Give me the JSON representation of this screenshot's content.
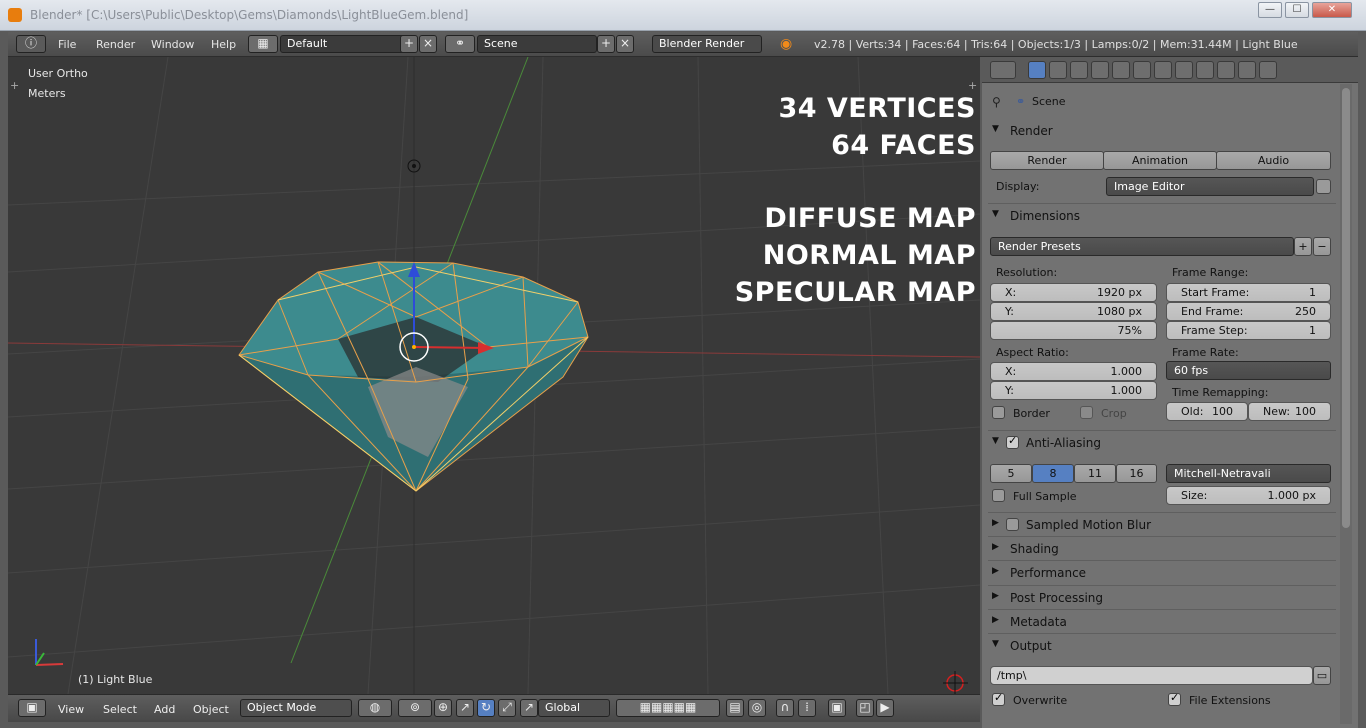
{
  "window": {
    "title": "Blender* [C:\\Users\\Public\\Desktop\\Gems\\Diamonds\\LightBlueGem.blend]",
    "controls": [
      "—",
      "☐",
      "✕"
    ]
  },
  "topbar": {
    "menus": [
      "File",
      "Render",
      "Window",
      "Help"
    ],
    "screen_layout": "Default",
    "scene": "Scene",
    "engine": "Blender Render",
    "info": "v2.78 | Verts:34 | Faces:64 | Tris:64 | Objects:1/3 | Lamps:0/2 | Mem:31.44M | Light Blue"
  },
  "viewport": {
    "view_label": "User Ortho",
    "units_label": "Meters",
    "object_label": "(1) Light Blue",
    "overlay": [
      "34 VERTICES",
      "64 FACES",
      "DIFFUSE MAP",
      "NORMAL MAP",
      "SPECULAR MAP"
    ]
  },
  "bottombar": {
    "menus": [
      "View",
      "Select",
      "Add",
      "Object"
    ],
    "mode": "Object Mode",
    "orientation": "Global"
  },
  "properties": {
    "breadcrumb": "Scene",
    "render": {
      "title": "Render",
      "buttons": [
        "Render",
        "Animation",
        "Audio"
      ],
      "display_label": "Display:",
      "display_value": "Image Editor"
    },
    "dimensions": {
      "title": "Dimensions",
      "presets": "Render Presets",
      "resolution_label": "Resolution:",
      "res_x_key": "X:",
      "res_x": "1920 px",
      "res_y_key": "Y:",
      "res_y": "1080 px",
      "res_pct": "75%",
      "frame_range_label": "Frame Range:",
      "start_key": "Start Frame:",
      "start": "1",
      "end_key": "End Frame:",
      "end": "250",
      "step_key": "Frame Step:",
      "step": "1",
      "aspect_label": "Aspect Ratio:",
      "asp_x_key": "X:",
      "asp_x": "1.000",
      "asp_y_key": "Y:",
      "asp_y": "1.000",
      "frame_rate_label": "Frame Rate:",
      "fps": "60 fps",
      "remap_label": "Time Remapping:",
      "old_key": "Old:",
      "old": "100",
      "new_key": "New:",
      "new": "100",
      "border": "Border",
      "crop": "Crop"
    },
    "anti_aliasing": {
      "title": "Anti-Aliasing",
      "samples": [
        "5",
        "8",
        "11",
        "16"
      ],
      "selected_sample": "8",
      "filter": "Mitchell-Netravali",
      "full_sample": "Full Sample",
      "size_key": "Size:",
      "size": "1.000 px"
    },
    "collapsed": [
      "Sampled Motion Blur",
      "Shading",
      "Performance",
      "Post Processing",
      "Metadata"
    ],
    "output": {
      "title": "Output",
      "path": "/tmp\\",
      "overwrite": "Overwrite",
      "file_extensions": "File Extensions"
    }
  },
  "colors": {
    "accent": "#5680c2",
    "wire": "#f0a64a",
    "gem": "#2e7f86"
  }
}
